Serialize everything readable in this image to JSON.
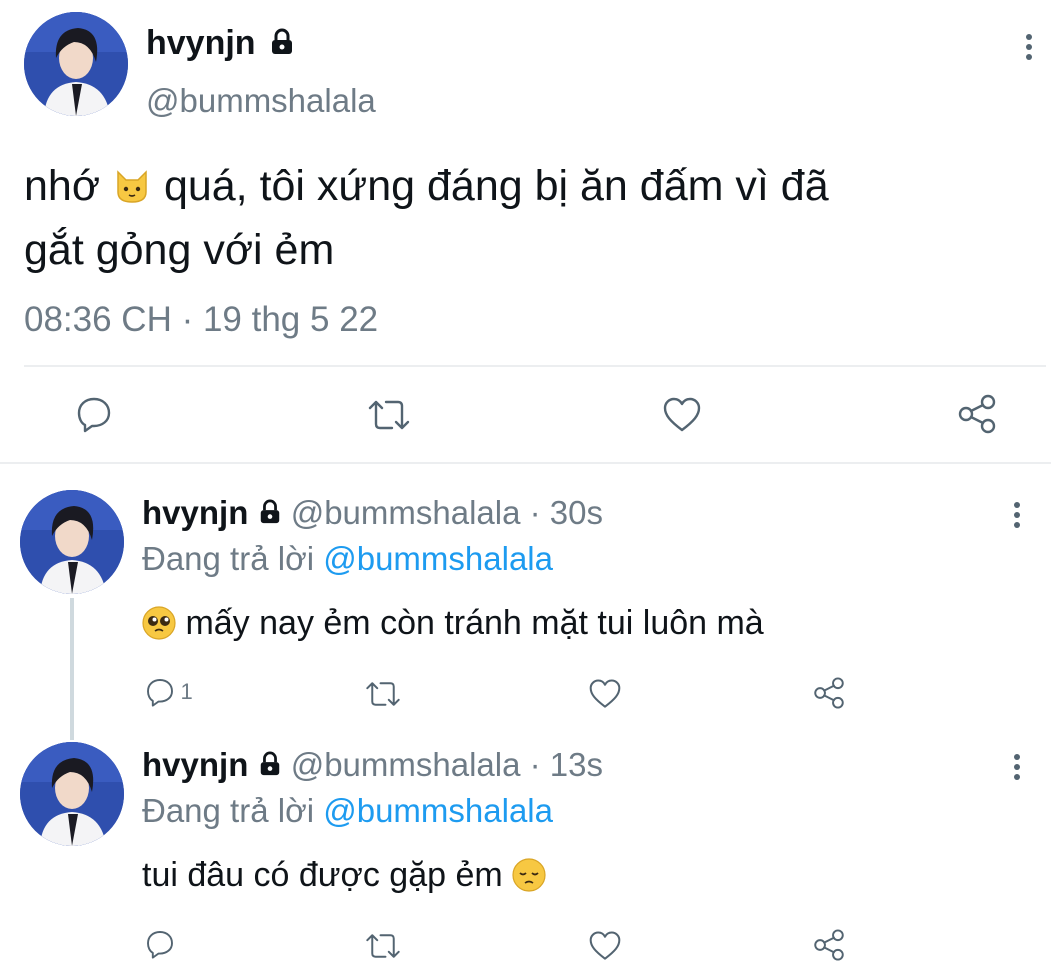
{
  "main_tweet": {
    "display_name": "hvynjn",
    "handle": "@bummshalala",
    "text_part1": "nhớ",
    "text_part2": "quá, tôi xứng đáng bị ăn đấm vì đã",
    "text_line2": "gắt gỏng với ẻm",
    "emoji": "cat-face-emoji",
    "timestamp": "08:36 CH · 19 thg 5 22"
  },
  "replies": [
    {
      "display_name": "hvynjn",
      "handle_time": "@bummshalala · 30s",
      "replying_prefix": "Đang trả lời",
      "replying_to": "@bummshalala",
      "text": "mấy nay ẻm còn tránh mặt tui luôn mà",
      "emoji": "pleading-face-emoji",
      "reply_count": "1"
    },
    {
      "display_name": "hvynjn",
      "handle_time": "@bummshalala · 13s",
      "replying_prefix": "Đang trả lời",
      "replying_to": "@bummshalala",
      "text": "tui đâu có được gặp ẻm",
      "emoji": "pensive-face-emoji",
      "reply_count": ""
    }
  ],
  "colors": {
    "accent": "#1d9bf0",
    "secondary_text": "#6e7b86",
    "avatar_bg": "#2f4fae",
    "thread_line": "#cfd9de"
  }
}
